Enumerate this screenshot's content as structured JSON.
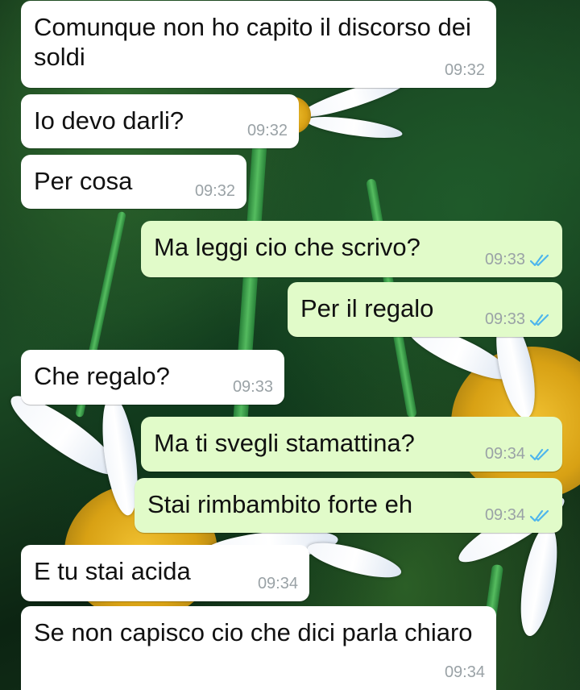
{
  "messages": [
    {
      "direction": "incoming",
      "text": "Comunque non ho capito il discorso dei soldi",
      "time": "09:32"
    },
    {
      "direction": "incoming",
      "text": "Io devo darli?",
      "time": "09:32"
    },
    {
      "direction": "incoming",
      "text": "Per cosa",
      "time": "09:32"
    },
    {
      "direction": "outgoing",
      "text": "Ma leggi cio che scrivo?",
      "time": "09:33",
      "status": "read"
    },
    {
      "direction": "outgoing",
      "text": "Per il regalo",
      "time": "09:33",
      "status": "read"
    },
    {
      "direction": "incoming",
      "text": "Che regalo?",
      "time": "09:33"
    },
    {
      "direction": "outgoing",
      "text": "Ma ti svegli stamattina?",
      "time": "09:34",
      "status": "read"
    },
    {
      "direction": "outgoing",
      "text": "Stai rimbambito forte eh",
      "time": "09:34",
      "status": "read"
    },
    {
      "direction": "incoming",
      "text": "E tu stai acida",
      "time": "09:34"
    },
    {
      "direction": "incoming",
      "text": "Se non capisco cio che dici parla chiaro",
      "time": "09:34"
    }
  ],
  "colors": {
    "incoming_bubble": "#ffffff",
    "outgoing_bubble": "#e1fbc9",
    "timestamp": "#9aa2a6",
    "read_ticks": "#4fb6ec"
  },
  "icons": {
    "read_receipt": "double-check-icon"
  }
}
